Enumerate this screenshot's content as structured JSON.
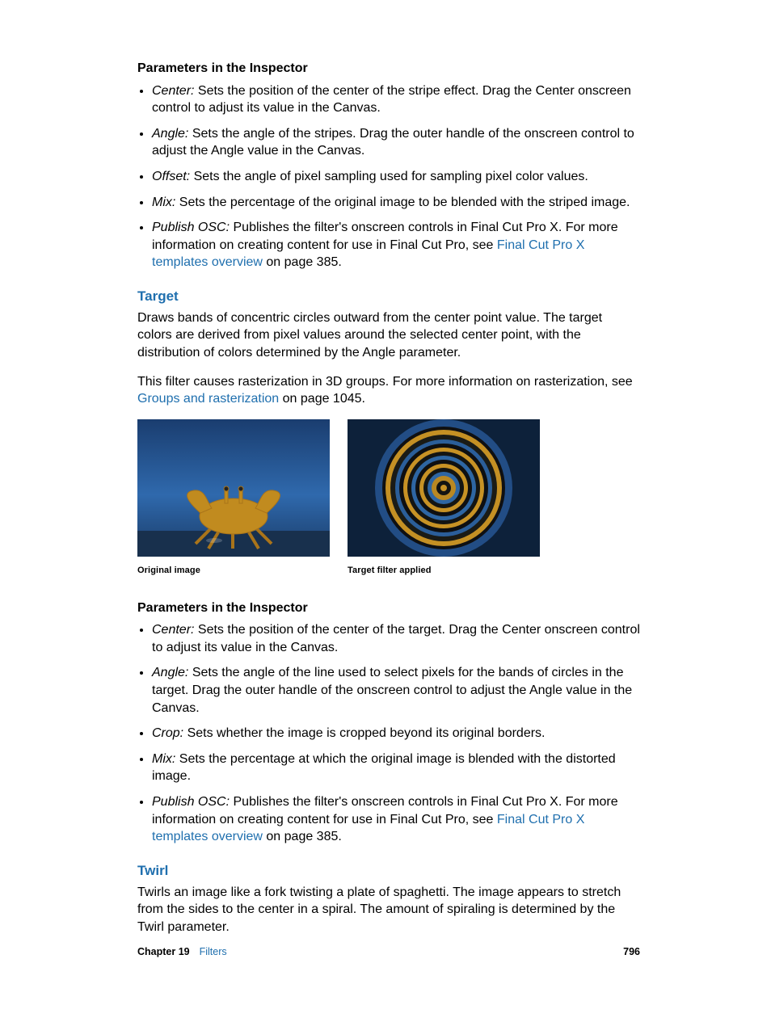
{
  "section1": {
    "title": "Parameters in the Inspector",
    "items": [
      {
        "term": "Center:",
        "text": " Sets the position of the center of the stripe effect. Drag the Center onscreen control to adjust its value in the Canvas."
      },
      {
        "term": "Angle:",
        "text": " Sets the angle of the stripes. Drag the outer handle of the onscreen control to adjust the Angle value in the Canvas."
      },
      {
        "term": "Offset:",
        "text": " Sets the angle of pixel sampling used for sampling pixel color values."
      },
      {
        "term": "Mix:",
        "text": " Sets the percentage of the original image to be blended with the striped image."
      },
      {
        "term": "Publish OSC:",
        "text": " Publishes the filter's onscreen controls in Final Cut Pro X. For more information on creating content for use in Final Cut Pro, see ",
        "link": "Final Cut Pro X templates overview",
        "after": " on page 385."
      }
    ]
  },
  "target": {
    "heading": "Target",
    "p1": "Draws bands of concentric circles outward from the center point value. The target colors are derived from pixel values around the selected center point, with the distribution of colors determined by the Angle parameter.",
    "p2_pre": "This filter causes rasterization in 3D groups. For more information on rasterization, see ",
    "p2_link": "Groups and rasterization",
    "p2_post": " on page 1045.",
    "fig1": "Original image",
    "fig2": "Target filter applied"
  },
  "section2": {
    "title": "Parameters in the Inspector",
    "items": [
      {
        "term": "Center:",
        "text": " Sets the position of the center of the target. Drag the Center onscreen control to adjust its value in the Canvas."
      },
      {
        "term": "Angle:",
        "text": " Sets the angle of the line used to select pixels for the bands of circles in the target. Drag the outer handle of the onscreen control to adjust the Angle value in the Canvas."
      },
      {
        "term": "Crop:",
        "text": " Sets whether the image is cropped beyond its original borders."
      },
      {
        "term": "Mix:",
        "text": " Sets the percentage at which the original image is blended with the distorted image."
      },
      {
        "term": "Publish OSC:",
        "text": " Publishes the filter's onscreen controls in Final Cut Pro X. For more information on creating content for use in Final Cut Pro, see ",
        "link": "Final Cut Pro X templates overview",
        "after": " on page 385."
      }
    ]
  },
  "twirl": {
    "heading": "Twirl",
    "p1": "Twirls an image like a fork twisting a plate of spaghetti. The image appears to stretch from the sides to the center in a spiral. The amount of spiraling is determined by the Twirl parameter."
  },
  "footer": {
    "chapter_label": "Chapter 19",
    "chapter_name": "Filters",
    "page_number": "796"
  }
}
